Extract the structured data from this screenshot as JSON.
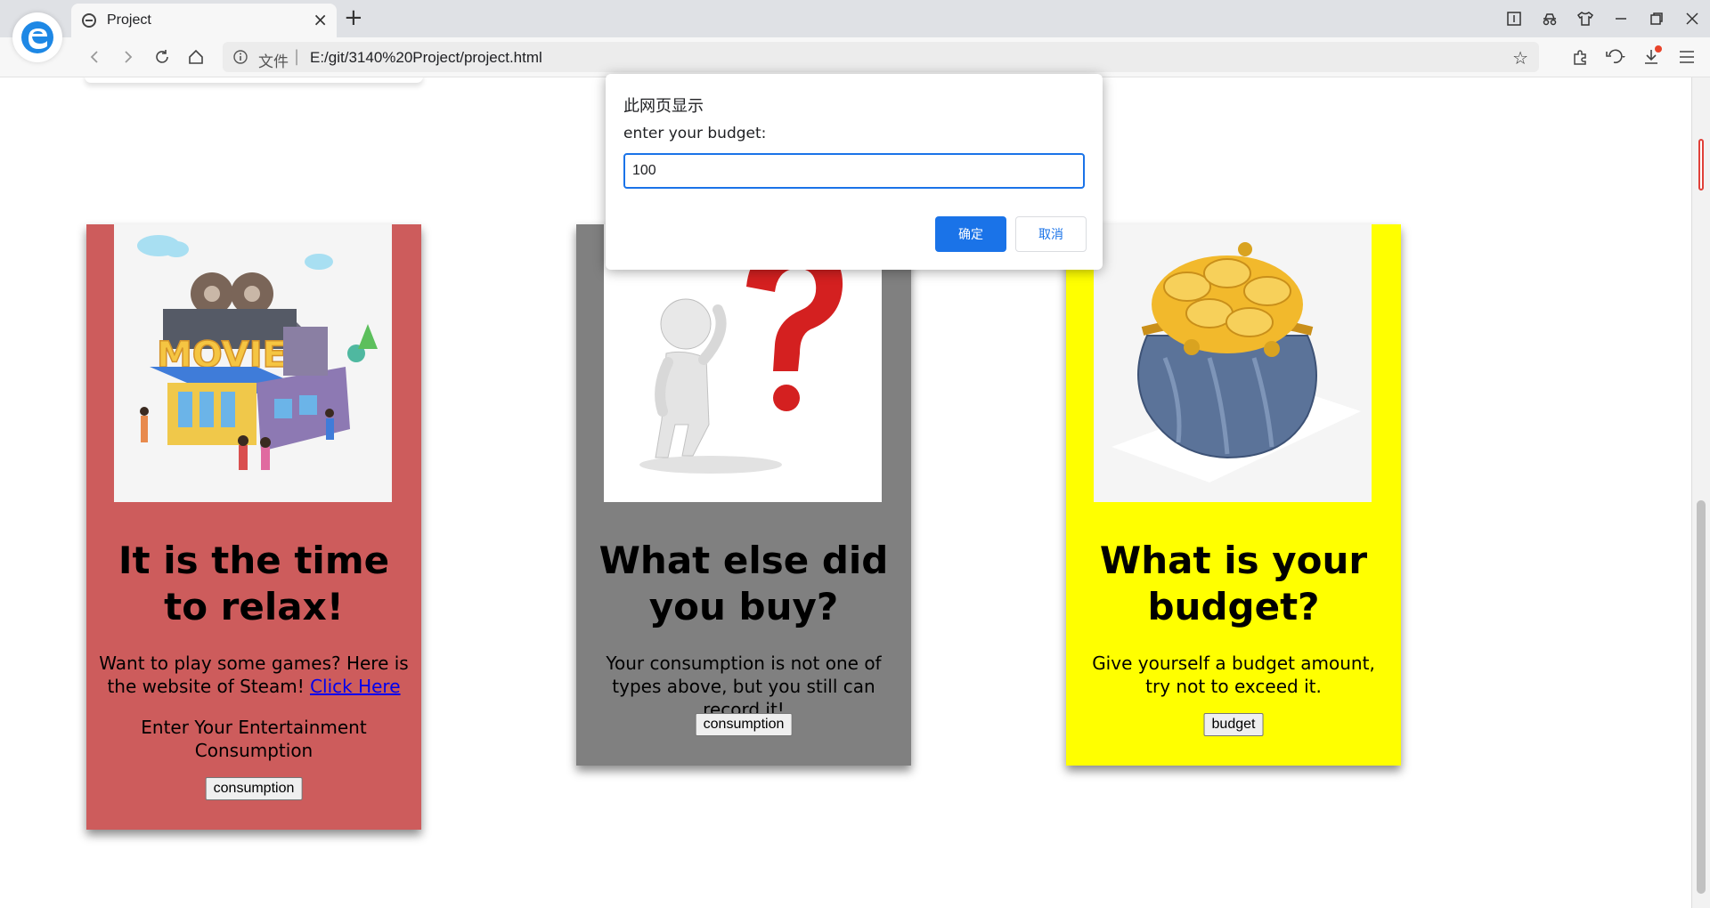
{
  "browser": {
    "tab_title": "Project",
    "address_label": "文件",
    "address_separator": "|",
    "url": "E:/git/3140%20Project/project.html",
    "icons": [
      "edge-logo-icon",
      "back-icon",
      "forward-icon",
      "reload-icon",
      "home-icon",
      "info-icon",
      "star-icon",
      "extensions-icon",
      "undo-icon",
      "download-icon",
      "menu-icon",
      "reading-mode-icon",
      "tracking-icon",
      "shirt-icon",
      "minimize-icon",
      "restore-icon",
      "close-icon"
    ]
  },
  "dialog": {
    "title": "此网页显示",
    "message": "enter your budget:",
    "input_value": "100",
    "ok_label": "确定",
    "cancel_label": "取消"
  },
  "cards": [
    {
      "bg": "#cd5c5c",
      "image": "movie-theater-illustration",
      "heading": "It is the time to relax!",
      "text_before_link": "Want to play some games? Here is the website of Steam! ",
      "link_text": "Click Here",
      "text2": "Enter Your Entertainment Consumption",
      "button": "consumption"
    },
    {
      "bg": "#808080",
      "image": "question-figure-illustration",
      "heading": "What else did you buy?",
      "text": "Your consumption is not one of types above, but you still can record it!",
      "button": "consumption"
    },
    {
      "bg": "#ffff00",
      "image": "coin-purse-illustration",
      "heading": "What is your budget?",
      "text": "Give yourself a budget amount, try not to exceed it.",
      "button": "budget"
    }
  ]
}
